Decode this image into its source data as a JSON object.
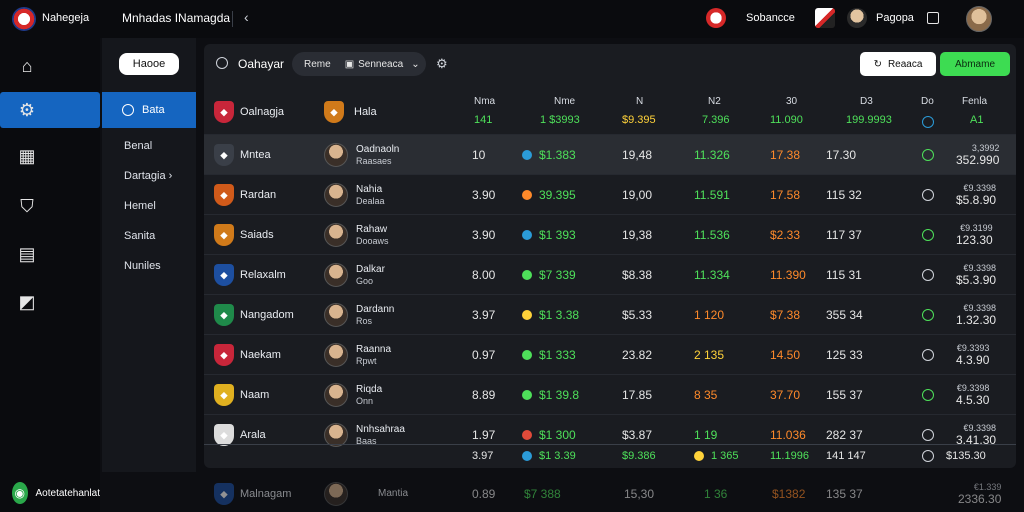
{
  "topbar": {
    "brand": "Nahegeja",
    "title": "Mnhadas INamagda",
    "right_items": [
      {
        "label": "Sobancce",
        "icon": "team-crest-icon"
      },
      {
        "label": "",
        "icon": "flag-icon"
      },
      {
        "label": "Pagopa",
        "icon": "user-icon"
      }
    ]
  },
  "sidebar": {
    "items": [
      {
        "icon": "home-icon",
        "glyph": "⌂"
      },
      {
        "icon": "gear-icon",
        "glyph": "⚙"
      },
      {
        "icon": "grid-icon",
        "glyph": "▦"
      },
      {
        "icon": "shield-icon",
        "glyph": "⛉"
      },
      {
        "icon": "chart-icon",
        "glyph": "▤"
      },
      {
        "icon": "tag-icon",
        "glyph": "◩"
      }
    ],
    "user": "Aotetatehanlat"
  },
  "submenu": {
    "button": "Haooe",
    "items": [
      "Bata",
      "Benal",
      "Dartagia ›",
      "Hemel",
      "Sanita",
      "Nuniles"
    ]
  },
  "panel": {
    "title": "Oahayar",
    "dropdown": {
      "a": "Reme",
      "b": "Senneaca",
      "arrow": "⌄"
    },
    "btn_outline": "Reaaca",
    "btn_green": "Abmame"
  },
  "table": {
    "headers": [
      {
        "label": "Nma",
        "value": "141"
      },
      {
        "label": "Nme",
        "value": "1 $3993"
      },
      {
        "label": "N",
        "value": "$9.395"
      },
      {
        "label": "N2",
        "value": "7.396"
      },
      {
        "label": "30",
        "value": "11.090"
      },
      {
        "label": "D3",
        "value": "199.9993"
      },
      {
        "label": "Do",
        "value": ""
      },
      {
        "label": "Fenla",
        "value": "A1"
      }
    ],
    "header_team": "Oalnagja",
    "header_player": "Hala",
    "rows": [
      {
        "team": "Mntea",
        "color": "#3a3f48",
        "player": "Oadnaoln",
        "psub": "Raasaes",
        "b": "10",
        "c": "$1.383",
        "d": "19,48",
        "e": "11.326",
        "f": "17.38",
        "g": "17.30",
        "h1": "3,3992",
        "h2": "352.990",
        "cdot": "#2b9bd8",
        "sel": true
      },
      {
        "team": "Rardan",
        "color": "#d05a1a",
        "player": "Nahia",
        "psub": "Dealaa",
        "b": "3.90",
        "c": "39.395",
        "d": "19,00",
        "e": "11.591",
        "f": "17.58",
        "g": "115  32",
        "h1": "€9.3398",
        "h2": "$5.8.90",
        "cdot": "#ff8a2a"
      },
      {
        "team": "Saiads",
        "color": "#d07a1a",
        "player": "Rahaw",
        "psub": "Dooaws",
        "b": "3.90",
        "c": "$1 393",
        "d": "19,38",
        "e": "11.536",
        "f": "$2.33",
        "g": "117  37",
        "h1": "€9.3199",
        "h2": "123.30",
        "cdot": "#2b9bd8"
      },
      {
        "team": "Relaxalm",
        "color": "#1d4fa0",
        "player": "Dalkar",
        "psub": "Goo",
        "b": "8.00",
        "c": "$7 339",
        "d": "$8.38",
        "e": "11.334",
        "f": "11.390",
        "g": "115  31",
        "h1": "€9.3398",
        "h2": "$5.3.90",
        "cdot": "#4ee05a"
      },
      {
        "team": "Nangadom",
        "color": "#1f8a4a",
        "player": "Dardann",
        "psub": "Ros",
        "b": "3.97",
        "c": "$1 3.38",
        "d": "$5.33",
        "e": "1  120",
        "f": "$7.38",
        "g": "355  34",
        "h1": "€9.3398",
        "h2": "1.32.30",
        "cdot": "#ffd23a"
      },
      {
        "team": "Naekam",
        "color": "#c8263a",
        "player": "Raanna",
        "psub": "Rpwt",
        "b": "0.97",
        "c": "$1 333",
        "d": "23.82",
        "e": "2  135",
        "f": "14.50",
        "g": "125  33",
        "h1": "€9.3393",
        "h2": "4.3.90",
        "cdot": "#4ee05a"
      },
      {
        "team": "Naam",
        "color": "#e0b020",
        "player": "Riqda",
        "psub": "Onn",
        "b": "8.89",
        "c": "$1 39.8",
        "d": "17.85",
        "e": "8  35",
        "f": "37.70",
        "g": "155  37",
        "h1": "€9.3398",
        "h2": "4.5.30",
        "cdot": "#4ee05a"
      },
      {
        "team": "Arala",
        "color": "#dcdcdc",
        "player": "Nnhsahraa",
        "psub": "Baas",
        "b": "1.97",
        "c": "$1 300",
        "d": "$3.87",
        "e": "1 19",
        "f": "11.036",
        "g": "282  37",
        "h1": "€9.3398",
        "h2": "3.41.30",
        "cdot": "#e24b3a"
      }
    ],
    "footer": {
      "b": "3.97",
      "c": "$1 3.39",
      "d": "$9.386",
      "e": "1 365",
      "f": "11.1996",
      "g": "141  147",
      "h": "$135.30"
    },
    "ghost": {
      "team": "Malnagam",
      "player": "Mantia",
      "b": "0.89",
      "c": "$7 388",
      "d": "15,30",
      "e": "1 36",
      "f": "$1382",
      "g": "135  37",
      "h1": "€1.339",
      "h2": "2336.30"
    }
  }
}
